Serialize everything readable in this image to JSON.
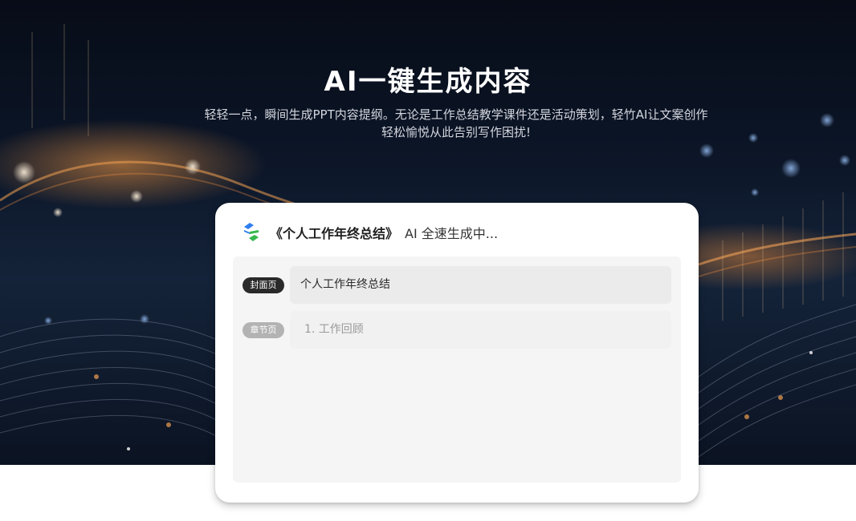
{
  "hero": {
    "title": "AI一键生成内容",
    "subtitle_line1": "轻轻一点，瞬间生成PPT内容提纲。无论是工作总结教学课件还是活动策划，轻竹AI让文案创作",
    "subtitle_line2": "轻松愉悦从此告别写作困扰!"
  },
  "card": {
    "logo_icon": "bamboo-logo-icon",
    "doc_title": "《个人工作年终总结》",
    "status": "AI 全速生成中...",
    "outline": [
      {
        "tag": "封面页",
        "text": "个人工作年终总结",
        "state": "active"
      },
      {
        "tag": "章节页",
        "text": "1. 工作回顾",
        "state": "pending"
      }
    ]
  },
  "colors": {
    "logo_blue": "#2f7ff0",
    "logo_green": "#36b84f",
    "tag_dark": "#2a2a2a",
    "tag_gray": "#b3b3b3"
  }
}
